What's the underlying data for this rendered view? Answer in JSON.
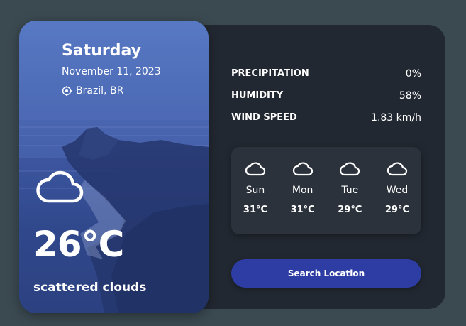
{
  "current": {
    "day": "Saturday",
    "date": "November 11, 2023",
    "location": "Brazil, BR",
    "location_icon": "map-pin-icon",
    "weather_icon": "cloud-icon",
    "temperature": "26°C",
    "description": "scattered clouds"
  },
  "stats": [
    {
      "label": "PRECIPITATION",
      "value": "0%"
    },
    {
      "label": "HUMIDITY",
      "value": "58%"
    },
    {
      "label": "WIND SPEED",
      "value": "1.83 km/h"
    }
  ],
  "forecast": [
    {
      "day": "Sun",
      "temp": "31°C",
      "icon": "cloud-icon"
    },
    {
      "day": "Mon",
      "temp": "31°C",
      "icon": "cloud-icon"
    },
    {
      "day": "Tue",
      "temp": "29°C",
      "icon": "cloud-icon"
    },
    {
      "day": "Wed",
      "temp": "29°C",
      "icon": "cloud-icon"
    }
  ],
  "search_button": "Search Location",
  "colors": {
    "page_bg": "#3b4a51",
    "panel_bg": "#222831",
    "forecast_bg": "#2b323b",
    "button_bg": "#2d3da3",
    "hero_gradient_top": "#5d7fc9",
    "hero_gradient_bottom": "#2a3d78"
  }
}
